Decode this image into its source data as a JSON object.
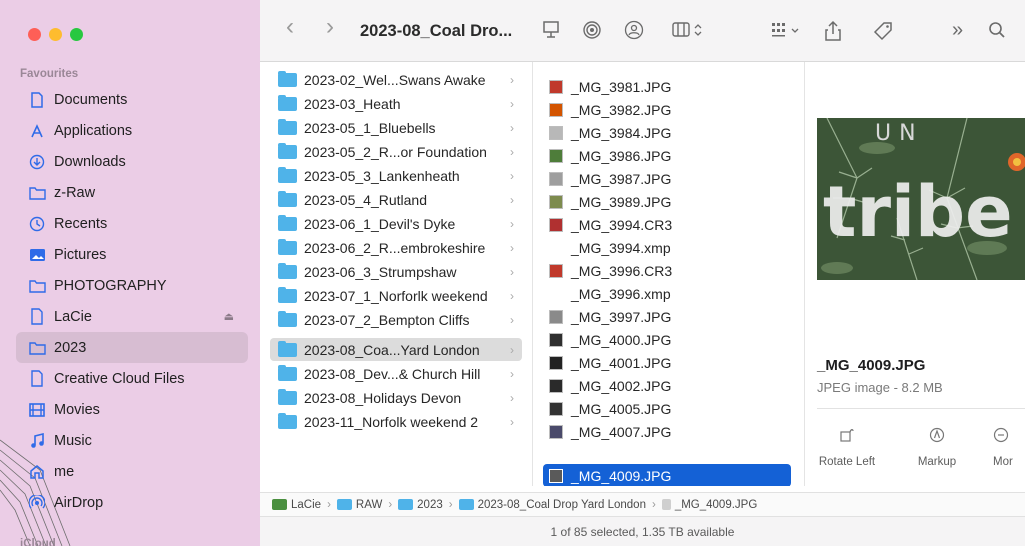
{
  "colors": {
    "sidebar_bg": "#ebcde6",
    "selection": "#1461d6",
    "folder": "#4fb3e9",
    "close": "#fe5f57",
    "minimize": "#febc2e",
    "zoom": "#28c840",
    "accent": "#2f6be8"
  },
  "sidebar": {
    "section_favourites": "Favourites",
    "section_icloud": "iCloud",
    "items": [
      {
        "label": "Documents",
        "icon": "document-icon"
      },
      {
        "label": "Applications",
        "icon": "applications-icon"
      },
      {
        "label": "Downloads",
        "icon": "downloads-icon"
      },
      {
        "label": "z-Raw",
        "icon": "folder-icon"
      },
      {
        "label": "Recents",
        "icon": "clock-icon"
      },
      {
        "label": "Pictures",
        "icon": "pictures-icon"
      },
      {
        "label": "PHOTOGRAPHY",
        "icon": "folder-icon"
      },
      {
        "label": "LaCie",
        "icon": "drive-icon"
      },
      {
        "label": "2023",
        "icon": "folder-icon",
        "selected": true
      },
      {
        "label": "Creative Cloud Files",
        "icon": "document-icon"
      },
      {
        "label": "Movies",
        "icon": "film-icon"
      },
      {
        "label": "Music",
        "icon": "music-icon"
      },
      {
        "label": "me",
        "icon": "home-icon"
      },
      {
        "label": "AirDrop",
        "icon": "airdrop-icon"
      }
    ]
  },
  "toolbar": {
    "title": "2023-08_Coal Dro...",
    "back": "‹",
    "forward": "›",
    "more": "»",
    "search_icon": "search-icon"
  },
  "folders": [
    {
      "name": "2023-02_Wel...Swans Awake"
    },
    {
      "name": "2023-03_Heath"
    },
    {
      "name": "2023-05_1_Bluebells"
    },
    {
      "name": "2023-05_2_R...or Foundation"
    },
    {
      "name": "2023-05_3_Lankenheath"
    },
    {
      "name": "2023-05_4_Rutland"
    },
    {
      "name": "2023-06_1_Devil's Dyke"
    },
    {
      "name": "2023-06_2_R...embrokeshire"
    },
    {
      "name": "2023-06_3_Strumpshaw"
    },
    {
      "name": "2023-07_1_Norforlk weekend"
    },
    {
      "name": "2023-07_2_Bempton Cliffs"
    },
    {
      "name": "2023-08_Coa...Yard London",
      "selected": true
    },
    {
      "name": "2023-08_Dev...& Church Hill"
    },
    {
      "name": "2023-08_Holidays Devon"
    },
    {
      "name": "2023-11_Norfolk weekend 2"
    }
  ],
  "files": [
    {
      "name": "_MG_3981.JPG",
      "thumb": "#c0392b"
    },
    {
      "name": "_MG_3982.JPG",
      "thumb": "#d35400"
    },
    {
      "name": "_MG_3984.JPG",
      "thumb": "#b8b8b8"
    },
    {
      "name": "_MG_3986.JPG",
      "thumb": "#4e7d3a"
    },
    {
      "name": "_MG_3987.JPG",
      "thumb": "#9e9e9e"
    },
    {
      "name": "_MG_3989.JPG",
      "thumb": "#7d8b4e"
    },
    {
      "name": "_MG_3994.CR3",
      "thumb": "#b03030"
    },
    {
      "name": "_MG_3994.xmp",
      "thumb": ""
    },
    {
      "name": "_MG_3996.CR3",
      "thumb": "#c0392b"
    },
    {
      "name": "_MG_3996.xmp",
      "thumb": ""
    },
    {
      "name": "_MG_3997.JPG",
      "thumb": "#8a8a8a"
    },
    {
      "name": "_MG_4000.JPG",
      "thumb": "#2f2f2f"
    },
    {
      "name": "_MG_4001.JPG",
      "thumb": "#222222"
    },
    {
      "name": "_MG_4002.JPG",
      "thumb": "#2a2a2a"
    },
    {
      "name": "_MG_4005.JPG",
      "thumb": "#333333"
    },
    {
      "name": "_MG_4007.JPG",
      "thumb": "#4a4a6a"
    },
    {
      "name": "_MG_4009.JPG",
      "thumb": "#5a5a5a",
      "selected": true
    }
  ],
  "preview": {
    "image_text": "tribe",
    "image_top_text": "UN",
    "name": "_MG_4009.JPG",
    "kind": "JPEG image - 8.2 MB",
    "actions": [
      {
        "label": "Rotate Left",
        "icon": "rotate-left-icon"
      },
      {
        "label": "Markup",
        "icon": "markup-icon"
      },
      {
        "label": "Mor",
        "icon": "more-icon"
      }
    ]
  },
  "pathbar": {
    "items": [
      {
        "label": "LaCie",
        "icon": "drive-icon"
      },
      {
        "label": "RAW",
        "icon": "folder-icon"
      },
      {
        "label": "2023",
        "icon": "folder-icon"
      },
      {
        "label": "2023-08_Coal Drop Yard London",
        "icon": "folder-icon"
      },
      {
        "label": "_MG_4009.JPG",
        "icon": "file-icon"
      }
    ]
  },
  "status": "1 of 85 selected, 1.35 TB available"
}
